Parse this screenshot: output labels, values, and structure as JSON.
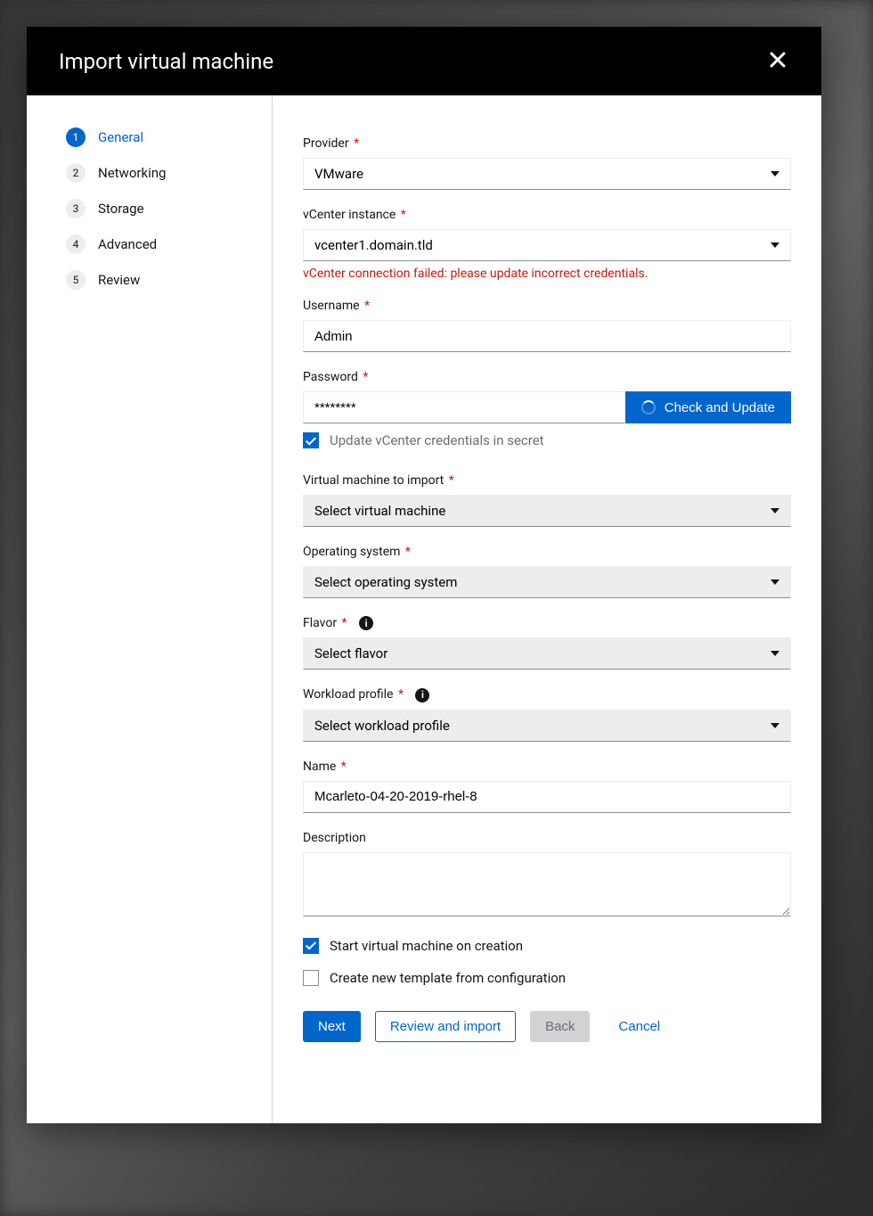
{
  "modal": {
    "title": "Import virtual machine"
  },
  "sidebar": {
    "steps": [
      {
        "num": "1",
        "label": "General"
      },
      {
        "num": "2",
        "label": "Networking"
      },
      {
        "num": "3",
        "label": "Storage"
      },
      {
        "num": "4",
        "label": "Advanced"
      },
      {
        "num": "5",
        "label": "Review"
      }
    ]
  },
  "form": {
    "provider": {
      "label": "Provider",
      "value": "VMware"
    },
    "vcenter": {
      "label": "vCenter instance",
      "value": "vcenter1.domain.tld",
      "error": "vCenter connection failed: please update incorrect credentials."
    },
    "username": {
      "label": "Username",
      "value": "Admin"
    },
    "password": {
      "label": "Password",
      "value": "********",
      "button": "Check and Update"
    },
    "updateSecret": {
      "label": "Update vCenter credentials in secret",
      "checked": true
    },
    "vmImport": {
      "label": "Virtual machine to import",
      "placeholder": "Select virtual machine"
    },
    "os": {
      "label": "Operating system",
      "placeholder": "Select operating system"
    },
    "flavor": {
      "label": "Flavor",
      "placeholder": "Select flavor"
    },
    "workload": {
      "label": "Workload profile",
      "placeholder": "Select workload profile"
    },
    "name": {
      "label": "Name",
      "value": "Mcarleto-04-20-2019-rhel-8"
    },
    "description": {
      "label": "Description"
    },
    "startVm": {
      "label": "Start virtual machine on creation",
      "checked": true
    },
    "createTemplate": {
      "label": "Create new template from configuration",
      "checked": false
    }
  },
  "footer": {
    "next": "Next",
    "review": "Review and import",
    "back": "Back",
    "cancel": "Cancel"
  }
}
